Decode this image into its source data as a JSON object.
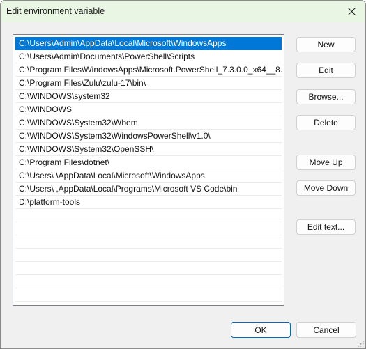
{
  "window": {
    "title": "Edit environment variable",
    "close_icon": "close-icon"
  },
  "list": {
    "selected_index": 0,
    "items": [
      "C:\\Users\\Admin\\AppData\\Local\\Microsoft\\WindowsApps",
      "C:\\Users\\Admin\\Documents\\PowerShell\\Scripts",
      "C:\\Program Files\\WindowsApps\\Microsoft.PowerShell_7.3.0.0_x64__8...",
      "C:\\Program Files\\Zulu\\zulu-17\\bin\\",
      "C:\\WINDOWS\\system32",
      "C:\\WINDOWS",
      "C:\\WINDOWS\\System32\\Wbem",
      "C:\\WINDOWS\\System32\\WindowsPowerShell\\v1.0\\",
      "C:\\WINDOWS\\System32\\OpenSSH\\",
      "C:\\Program Files\\dotnet\\",
      "C:\\Users\\          \\AppData\\Local\\Microsoft\\WindowsApps",
      "C:\\Users\\          ,AppData\\Local\\Programs\\Microsoft VS Code\\bin",
      "D:\\platform-tools",
      "",
      "",
      "",
      "",
      "",
      "",
      ""
    ]
  },
  "buttons": {
    "new": "New",
    "edit": "Edit",
    "browse": "Browse...",
    "delete": "Delete",
    "move_up": "Move Up",
    "move_down": "Move Down",
    "edit_text": "Edit text...",
    "ok": "OK",
    "cancel": "Cancel"
  },
  "colors": {
    "selection": "#0078d7",
    "titlebar": "#eaf6e4",
    "default_button_border": "#0067c0"
  }
}
